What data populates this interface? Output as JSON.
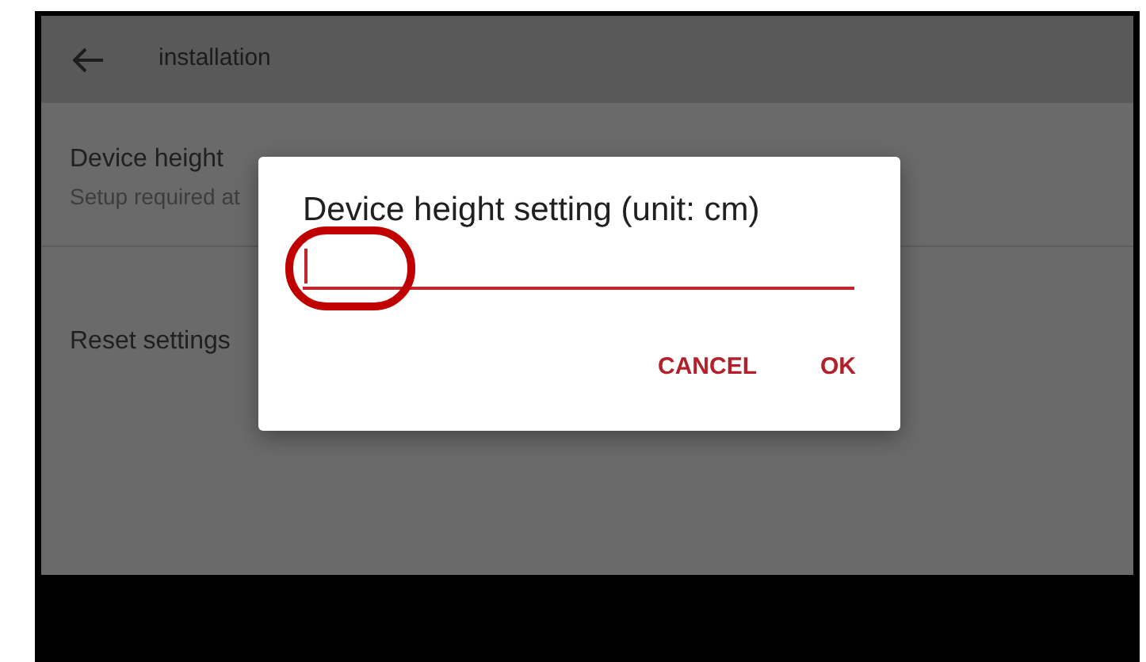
{
  "app_bar": {
    "title": "installation"
  },
  "settings": [
    {
      "title": "Device height",
      "subtitle": "Setup required at"
    },
    {
      "title": "Reset settings"
    }
  ],
  "dialog": {
    "title": "Device height setting (unit: cm)",
    "input": {
      "focused": true
    },
    "buttons": [
      "CANCEL",
      "OK"
    ]
  }
}
